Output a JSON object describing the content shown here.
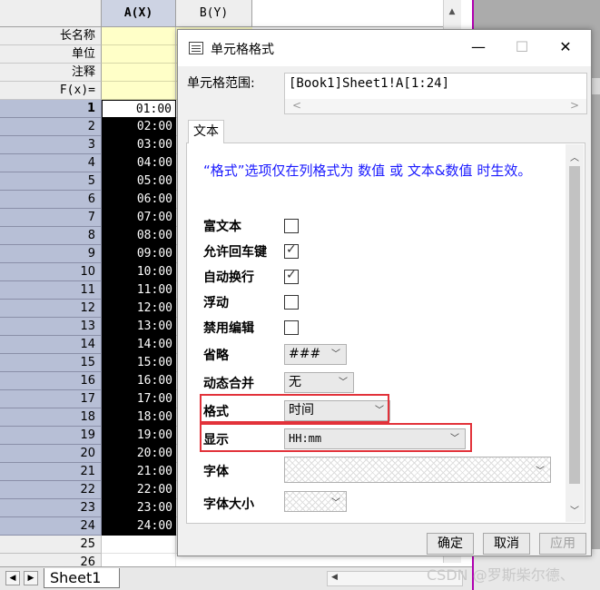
{
  "sheet": {
    "col_a": "A(X)",
    "col_b": "B(Y)",
    "meta_labels": [
      "长名称",
      "单位",
      "注释",
      "F(x)="
    ],
    "rows": [
      {
        "n": "1",
        "v": "01:00"
      },
      {
        "n": "2",
        "v": "02:00"
      },
      {
        "n": "3",
        "v": "03:00"
      },
      {
        "n": "4",
        "v": "04:00"
      },
      {
        "n": "5",
        "v": "05:00"
      },
      {
        "n": "6",
        "v": "06:00"
      },
      {
        "n": "7",
        "v": "07:00"
      },
      {
        "n": "8",
        "v": "08:00"
      },
      {
        "n": "9",
        "v": "09:00"
      },
      {
        "n": "10",
        "v": "10:00"
      },
      {
        "n": "11",
        "v": "11:00"
      },
      {
        "n": "12",
        "v": "12:00"
      },
      {
        "n": "13",
        "v": "13:00"
      },
      {
        "n": "14",
        "v": "14:00"
      },
      {
        "n": "15",
        "v": "15:00"
      },
      {
        "n": "16",
        "v": "16:00"
      },
      {
        "n": "17",
        "v": "17:00"
      },
      {
        "n": "18",
        "v": "18:00"
      },
      {
        "n": "19",
        "v": "19:00"
      },
      {
        "n": "20",
        "v": "20:00"
      },
      {
        "n": "21",
        "v": "21:00"
      },
      {
        "n": "22",
        "v": "22:00"
      },
      {
        "n": "23",
        "v": "23:00"
      },
      {
        "n": "24",
        "v": "24:00"
      },
      {
        "n": "25",
        "v": ""
      },
      {
        "n": "26",
        "v": ""
      }
    ],
    "tab_name": "Sheet1"
  },
  "dialog": {
    "title": "单元格格式",
    "min": "—",
    "max": "☐",
    "close": "✕",
    "range_label": "单元格范围:",
    "range_value": "[Book1]Sheet1!A[1:24]",
    "tab": "文本",
    "note": "“格式”选项仅在列格式为 数值 或 文本&数值 时生效。",
    "labels": {
      "rich_text": "富文本",
      "allow_enter": "允许回车键",
      "auto_wrap": "自动换行",
      "float": "浮动",
      "disable_edit": "禁用编辑",
      "ellipsis": "省略",
      "dyn_merge": "动态合并",
      "format": "格式",
      "display": "显示",
      "font": "字体",
      "font_size": "字体大小"
    },
    "checks": {
      "rich_text": false,
      "allow_enter": true,
      "auto_wrap": true,
      "float": false,
      "disable_edit": false
    },
    "values": {
      "ellipsis": "###",
      "dyn_merge": "无",
      "format": "时间",
      "display": "HH:mm"
    },
    "buttons": {
      "ok": "确定",
      "cancel": "取消",
      "apply": "应用"
    }
  },
  "watermark": "CSDN @罗斯柴尔德、",
  "colors": {
    "highlight": "#e2323a",
    "note": "#1a1aff",
    "row_header": "#b7bfd6"
  }
}
